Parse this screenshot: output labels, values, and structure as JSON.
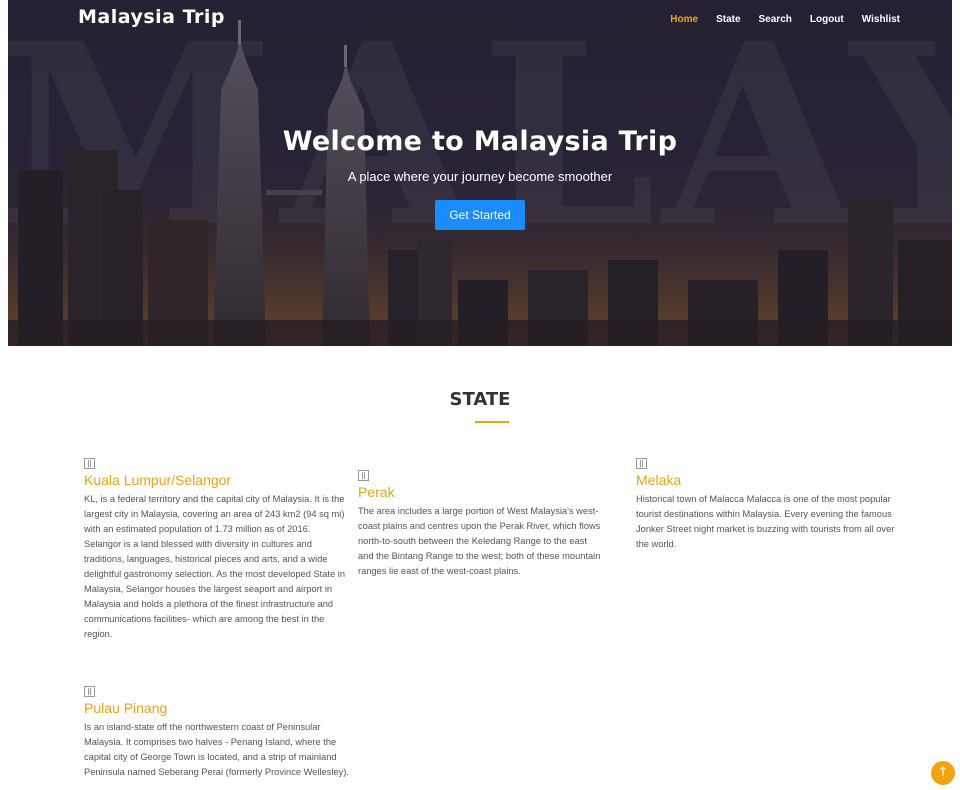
{
  "header": {
    "brand": "Malaysia Trip",
    "nav": [
      {
        "label": "Home",
        "active": true
      },
      {
        "label": "State",
        "active": false
      },
      {
        "label": "Search",
        "active": false
      },
      {
        "label": "Logout",
        "active": false
      },
      {
        "label": "Wishlist",
        "active": false
      }
    ]
  },
  "hero": {
    "watermark": "MALAYSIA",
    "title": "Welcome to Malaysia Trip",
    "subtitle": "A place where your journey become smoother",
    "button_label": "Get Started"
  },
  "state_section": {
    "title": "STATE",
    "cards": [
      {
        "icon": "map-icon",
        "title": "Kuala Lumpur/Selangor",
        "text": "KL, is a federal territory and the capital city of Malaysia. It is the largest city in Malaysia, covering an area of 243 km2 (94 sq mi) with an estimated population of 1.73 million as of 2016. Selangor is a land blessed with diversity in cultures and traditions, languages, historical pieces and arts, and a wide delightful gastronomy selection. As the most developed State in Malaysia, Selangor houses the largest seaport and airport in Malaysia and holds a plethora of the finest infrastructure and communications facilities- which are among the best in the region."
      },
      {
        "icon": "map-icon",
        "title": "Perak",
        "text": "The area includes a large portion of West Malaysia's west-coast plains and centres upon the Perak River, which flows north-to-south between the Keledang Range to the east and the Bintang Range to the west; both of these mountain ranges lie east of the west-coast plains."
      },
      {
        "icon": "map-icon",
        "title": "Melaka",
        "text": "Historical town of Malacca Malacca is one of the most popular tourist destinations within Malaysia. Every evening the famous Jonker Street night market is buzzing with tourists from all over the world."
      },
      {
        "icon": "map-icon",
        "title": "Pulau Pinang",
        "text": "Is an island-state off the northwestern coast of Peninsular Malaysia. It comprises two halves - Penang Island, where the capital city of George Town is located, and a strip of mainland Peninsula named Seberang Perai (formerly Province Wellesley)."
      }
    ]
  },
  "scroll_top": {
    "icon": "arrow-up-icon",
    "glyph": "↑"
  },
  "colors": {
    "accent": "#e8a417",
    "button": "#1a8cff",
    "heading": "#333333"
  }
}
